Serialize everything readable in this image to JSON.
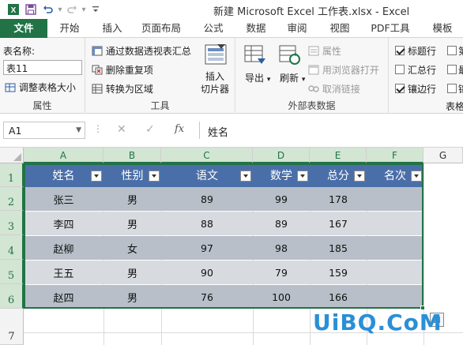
{
  "window": {
    "title": "新建 Microsoft Excel 工作表.xlsx - Excel"
  },
  "ribbon_tabs": [
    {
      "label": "文件",
      "active": false
    },
    {
      "label": "开始"
    },
    {
      "label": "插入"
    },
    {
      "label": "页面布局"
    },
    {
      "label": "公式"
    },
    {
      "label": "数据"
    },
    {
      "label": "审阅"
    },
    {
      "label": "视图"
    },
    {
      "label": "PDF工具"
    },
    {
      "label": "模板"
    }
  ],
  "ribbon": {
    "properties": {
      "table_name_label": "表名称:",
      "table_name_value": "表11",
      "resize_label": "调整表格大小",
      "group_label": "属性"
    },
    "tools": {
      "pivot_label": "通过数据透视表汇总",
      "dedupe_label": "删除重复项",
      "convert_label": "转换为区域",
      "slicer_label_1": "插入",
      "slicer_label_2": "切片器",
      "group_label": "工具"
    },
    "external": {
      "export_label": "导出",
      "refresh_label": "刷新",
      "properties_label": "属性",
      "browser_label": "用浏览器打开",
      "unlink_label": "取消链接",
      "group_label": "外部表数据"
    },
    "style_options": {
      "header_row": {
        "label": "标题行",
        "checked": true
      },
      "total_row": {
        "label": "汇总行",
        "checked": false
      },
      "banded_rows": {
        "label": "镶边行",
        "checked": true
      },
      "c1": {
        "label": "第",
        "checked": false
      },
      "c2": {
        "label": "最",
        "checked": false
      },
      "c3": {
        "label": "镶",
        "checked": false
      },
      "group_label": "表格"
    }
  },
  "formula_bar": {
    "name_box": "A1",
    "fx": "fx",
    "content": "姓名"
  },
  "grid": {
    "columns": [
      "A",
      "B",
      "C",
      "D",
      "E",
      "F",
      "G"
    ],
    "rows": [
      "1",
      "2",
      "3",
      "4",
      "5",
      "6",
      "7"
    ],
    "table": {
      "headers": [
        "姓名",
        "性别",
        "语文",
        "数学",
        "总分",
        "名次"
      ],
      "rows": [
        [
          "张三",
          "男",
          "89",
          "99",
          "178",
          ""
        ],
        [
          "李四",
          "男",
          "88",
          "89",
          "167",
          ""
        ],
        [
          "赵柳",
          "女",
          "97",
          "98",
          "185",
          ""
        ],
        [
          "王五",
          "男",
          "90",
          "79",
          "159",
          ""
        ],
        [
          "赵四",
          "男",
          "76",
          "100",
          "166",
          ""
        ]
      ]
    }
  },
  "watermark": "UiBQ.CoM",
  "colors": {
    "excel_green": "#217346",
    "table_header": "#4a6fa8",
    "band_dark": "#b8bfc8",
    "band_light": "#d7dbe0"
  }
}
